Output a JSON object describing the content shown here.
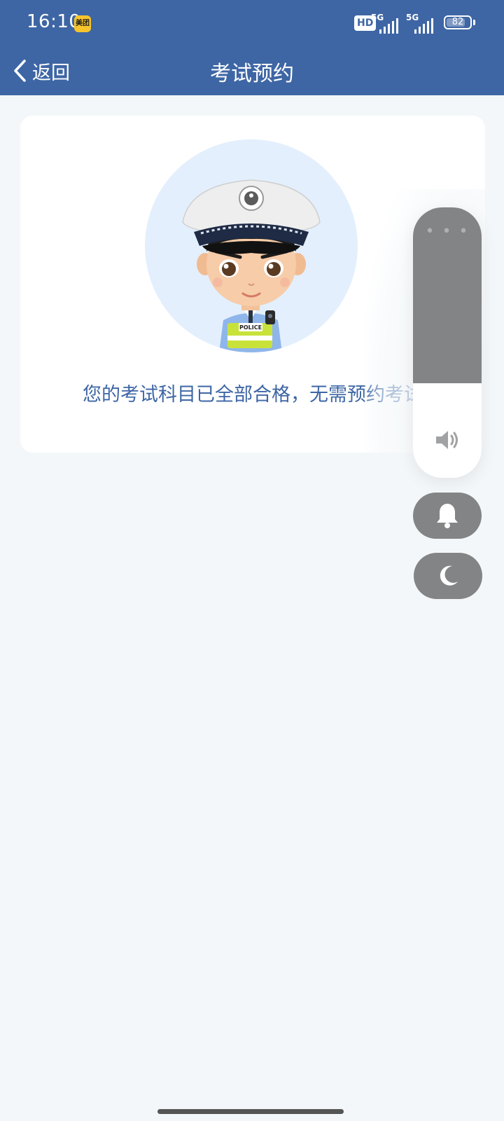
{
  "status_bar": {
    "time": "16:10",
    "app_badge": "美团",
    "hd": "HD",
    "network_1": "5G",
    "network_2": "5G",
    "battery": "82",
    "battery_level": 0.82
  },
  "nav": {
    "back_label": "返回",
    "title": "考试预约"
  },
  "card": {
    "message": "您的考试科目已全部合格，无需预约考试",
    "illustration_badge": "POLICE"
  },
  "volume_panel": {
    "level": 0.35,
    "icons": [
      "speaker-icon",
      "bell-icon",
      "moon-icon"
    ]
  },
  "colors": {
    "header": "#3e66a5",
    "page_background": "#f3f7f9",
    "avatar_background": "#e3effc",
    "panel_gray": "#838485"
  }
}
